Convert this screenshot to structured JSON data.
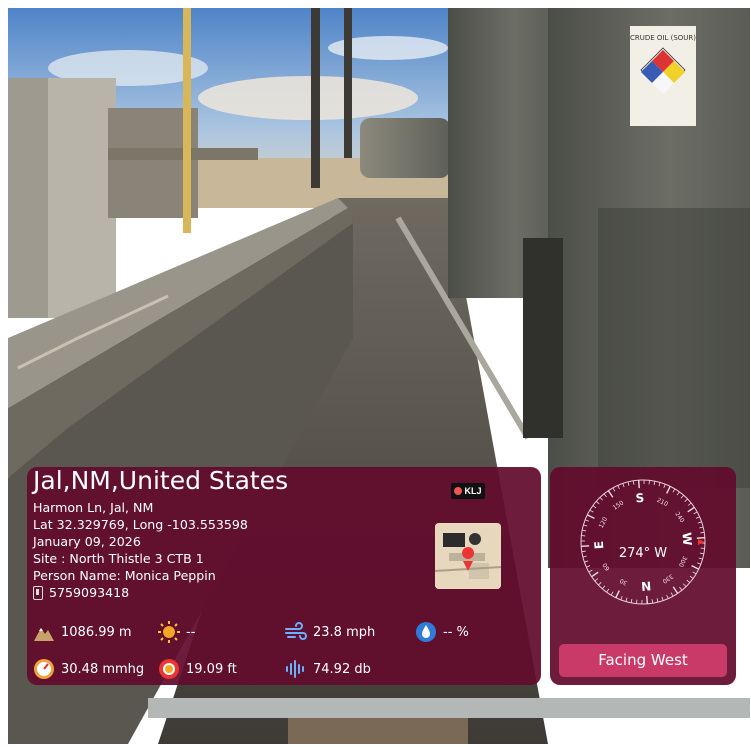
{
  "location": {
    "title": "Jal,NM,United States",
    "address": "Harmon Ln, Jal, NM",
    "coordinates": "Lat 32.329769, Long -103.553598",
    "date": "January 09, 2026",
    "site": "Site : North Thistle 3 CTB 1",
    "person": "Person Name: Monica Peppin",
    "phone": "5759093418"
  },
  "logo": {
    "text": "KLJ"
  },
  "tank_label": "CRUDE OIL (SOUR)",
  "metrics": {
    "altitude": "1086.99 m",
    "weather": "--",
    "wind": "23.8 mph",
    "humidity": "-- %",
    "pressure": "30.48 mmhg",
    "accuracy": "19.09 ft",
    "noise": "74.92 db"
  },
  "compass": {
    "reading": "274° W",
    "heading_degrees": 274,
    "labels": [
      "N",
      "E",
      "S",
      "W"
    ],
    "ticks": [
      "30",
      "60",
      "120",
      "150",
      "210",
      "240",
      "300",
      "330"
    ]
  },
  "facing_label": "Facing West",
  "colors": {
    "panel": "#620c2c",
    "button": "#c93a68",
    "sun": "#f5a623",
    "wind": "#6ab0ff"
  }
}
